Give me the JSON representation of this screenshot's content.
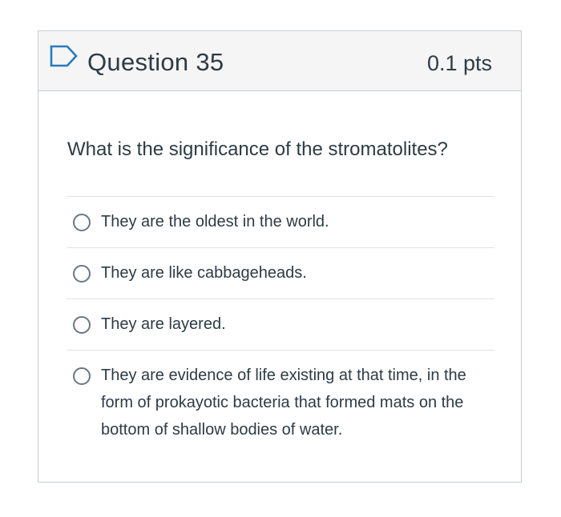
{
  "question": {
    "title": "Question 35",
    "points": "0.1 pts",
    "flag_icon": "flag-outline-icon",
    "text": "What is the significance of the stromatolites?"
  },
  "answers": [
    {
      "label": "They are the oldest in the world."
    },
    {
      "label": "They are like cabbageheads."
    },
    {
      "label": "They are layered."
    },
    {
      "label": "They are evidence of life existing at that time, in the form of prokayotic bacteria that formed mats on the bottom of shallow bodies of water."
    }
  ],
  "colors": {
    "text": "#2d3b45",
    "header_bg": "#f5f5f5",
    "border": "#c7cdd1",
    "flag": "#2b7abc"
  }
}
